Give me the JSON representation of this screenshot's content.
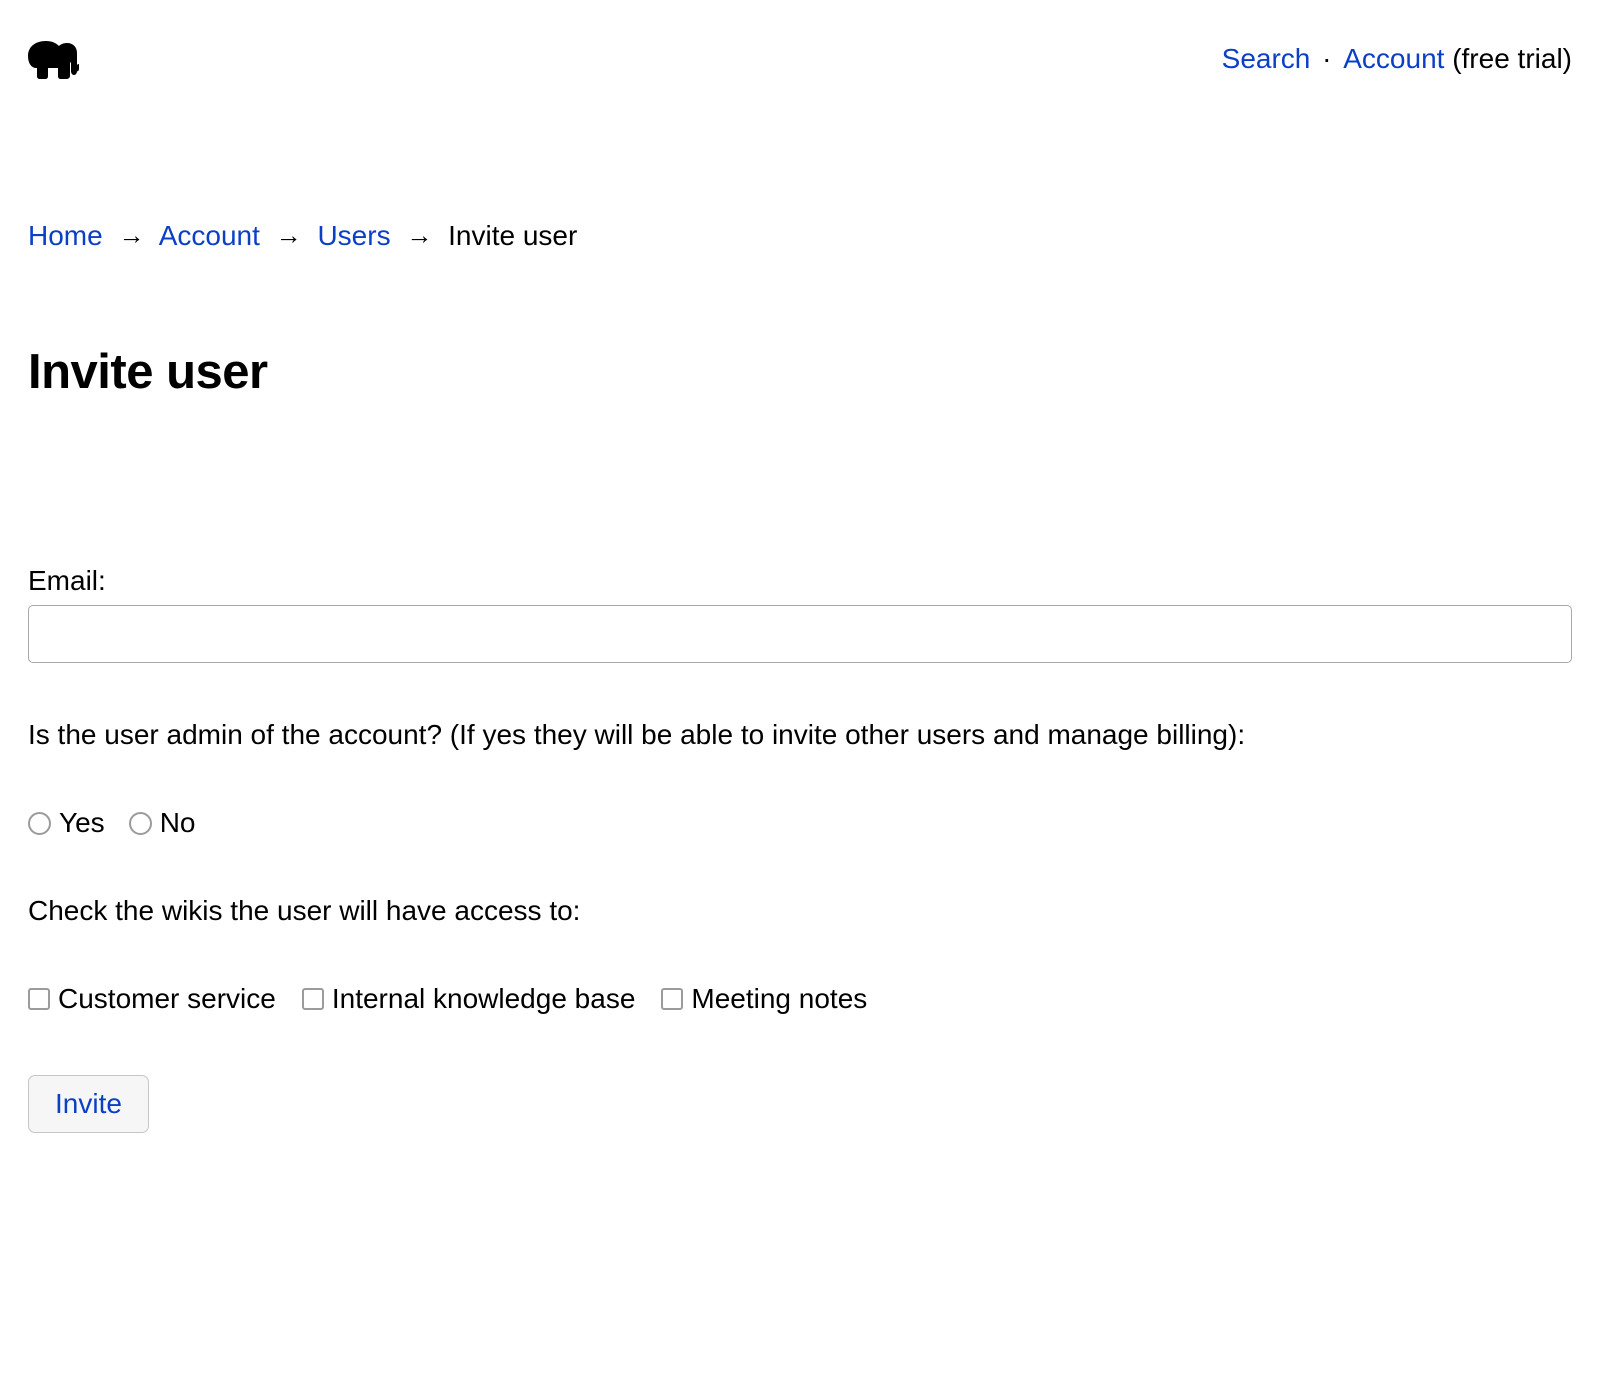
{
  "header": {
    "search_label": "Search",
    "account_label": "Account",
    "trial_label": "(free trial)"
  },
  "breadcrumb": {
    "home": "Home",
    "account": "Account",
    "users": "Users",
    "current": "Invite user"
  },
  "page": {
    "title": "Invite user"
  },
  "form": {
    "email_label": "Email:",
    "email_value": "",
    "admin_question": "Is the user admin of the account? (If yes they will be able to invite other users and manage billing):",
    "admin_yes": "Yes",
    "admin_no": "No",
    "wikis_label": "Check the wikis the user will have access to:",
    "wikis": {
      "0": "Customer service",
      "1": "Internal knowledge base",
      "2": "Meeting notes"
    },
    "submit_label": "Invite"
  }
}
